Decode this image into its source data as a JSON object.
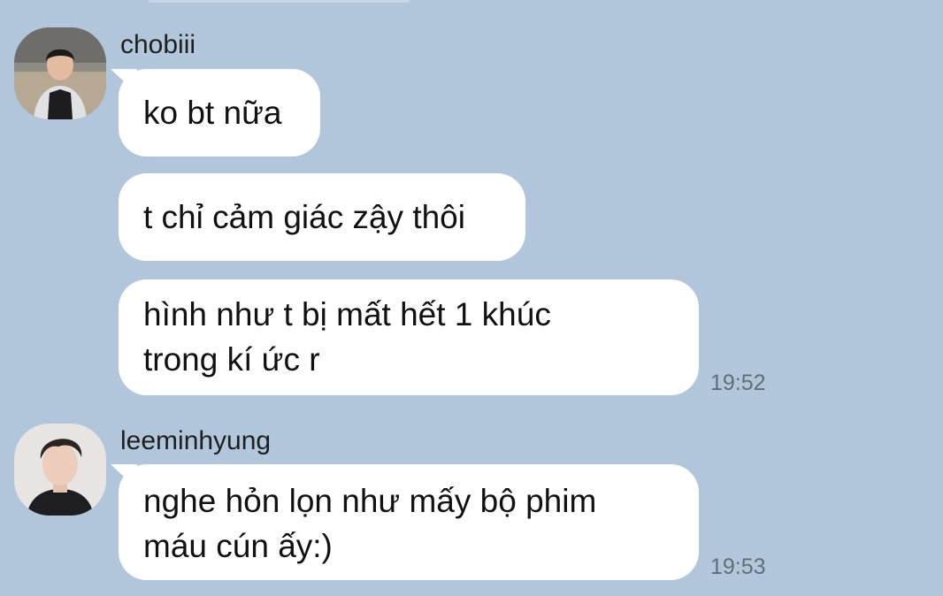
{
  "chat": {
    "groups": [
      {
        "sender": "chobiii",
        "avatar_icon": "user-avatar-photo",
        "messages": [
          {
            "text": "ko bt nữa"
          },
          {
            "text": "t chỉ cảm giác zậy thôi"
          },
          {
            "line1": "hình như t bị mất hết 1 khúc",
            "line2": "trong kí ức r",
            "time": "19:52"
          }
        ]
      },
      {
        "sender": "leeminhyung",
        "avatar_icon": "user-avatar-photo",
        "messages": [
          {
            "line1": "nghe hỏn lọn như mấy bộ phim",
            "line2": "máu cún ấy:)",
            "time": "19:53"
          }
        ]
      }
    ]
  },
  "colors": {
    "background": "#b1c6db",
    "bubble": "#ffffff",
    "timestamp": "#5f6e7c"
  }
}
